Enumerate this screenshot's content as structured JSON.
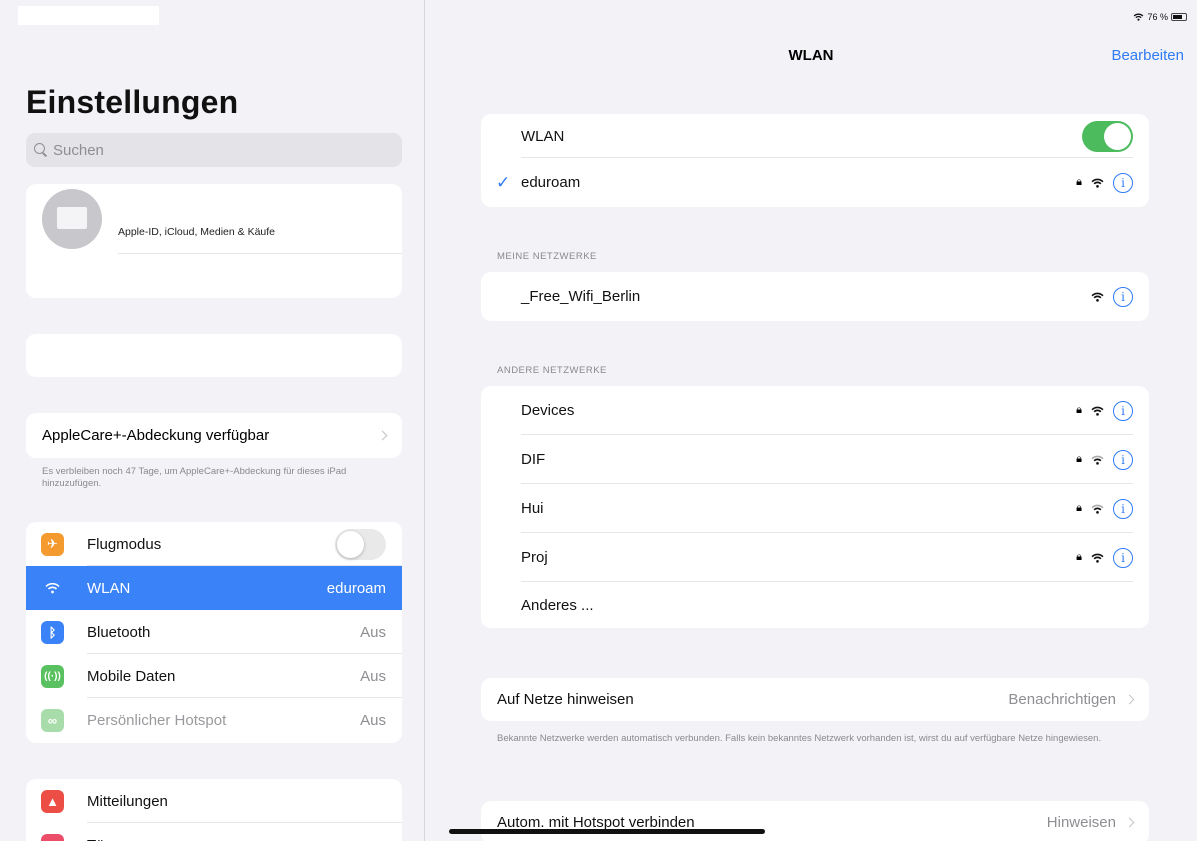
{
  "sidebar": {
    "title": "Einstellungen",
    "search_placeholder": "Suchen",
    "profile_sub": "Apple-ID, iCloud, Medien & Käufe",
    "applecare": {
      "label": "AppleCare+-Abdeckung verfügbar",
      "note": "Es verbleiben noch 47 Tage, um AppleCare+-Abdeckung für dieses iPad hinzuzufügen."
    },
    "items": [
      {
        "label": "Flugmodus",
        "value": "",
        "icon": "airplane-icon",
        "color": "#f49a2e"
      },
      {
        "label": "WLAN",
        "value": "eduroam",
        "icon": "wifi-icon",
        "color": "#3a82f7"
      },
      {
        "label": "Bluetooth",
        "value": "Aus",
        "icon": "bluetooth-icon",
        "color": "#3a82f7"
      },
      {
        "label": "Mobile Daten",
        "value": "Aus",
        "icon": "antenna-icon",
        "color": "#5ac160"
      },
      {
        "label": "Persönlicher Hotspot",
        "value": "Aus",
        "icon": "hotspot-icon",
        "color": "#a8dcab"
      }
    ],
    "next_items": [
      {
        "label": "Mitteilungen",
        "icon": "notifications-icon",
        "color": "#ec4e45"
      },
      {
        "label": "Tö",
        "icon": "sounds-icon",
        "color": "#ec4e6a"
      }
    ]
  },
  "status": {
    "battery": "76 %"
  },
  "main": {
    "nav_title": "WLAN",
    "edit": "Bearbeiten",
    "wlan_label": "WLAN",
    "connected": "eduroam",
    "my_networks_header": "MEINE NETZWERKE",
    "my_networks": [
      "_Free_Wifi_Berlin"
    ],
    "other_networks_header": "ANDERE NETZWERKE",
    "other_networks": [
      "Devices",
      "DIF",
      "Hui",
      "Proj"
    ],
    "other_label": "Anderes ...",
    "ask_join": {
      "label": "Auf Netze hinweisen",
      "value": "Benachrichtigen"
    },
    "ask_join_note": "Bekannte Netzwerke werden automatisch verbunden. Falls kein bekanntes Netzwerk vorhanden ist, wirst du auf verfügbare Netze hingewiesen.",
    "auto_hotspot": {
      "label": "Autom. mit Hotspot verbinden",
      "value": "Hinweisen"
    }
  },
  "colors": {
    "accent": "#2f7cf6",
    "toggle_on": "#4cbb5e",
    "selected_row": "#3a82f7"
  }
}
